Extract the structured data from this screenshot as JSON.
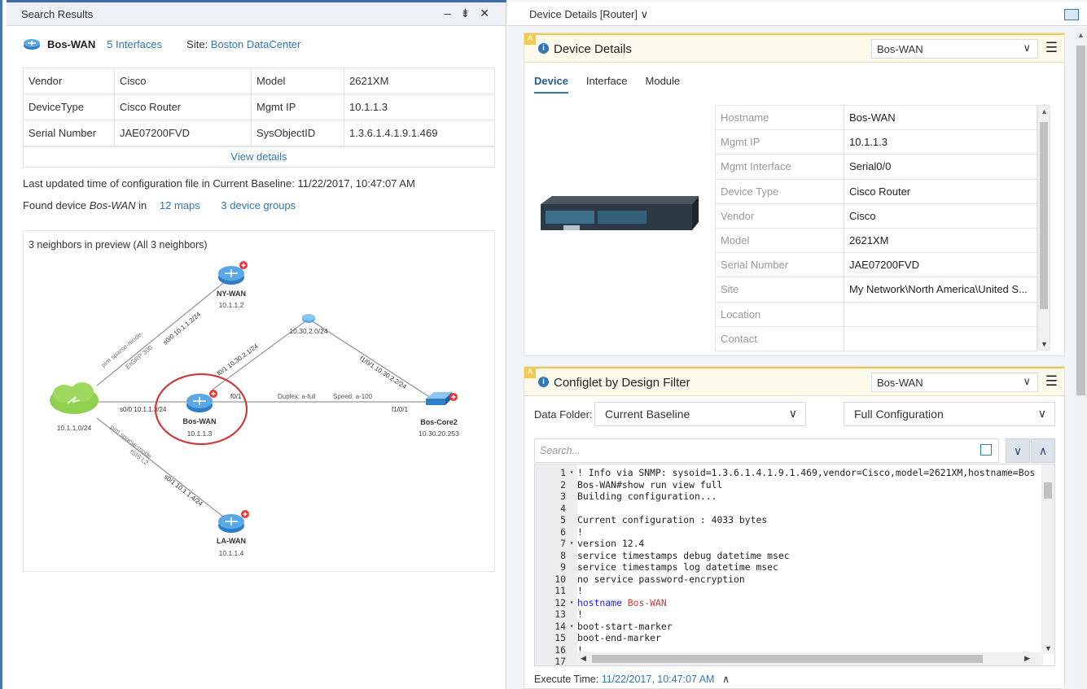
{
  "left": {
    "title": "Search Results",
    "window_buttons": [
      "–",
      "⇟",
      "✕"
    ],
    "device": {
      "name": "Bos-WAN",
      "interfaces": "5 Interfaces",
      "site_label": "Site:",
      "site": "Boston DataCenter"
    },
    "info_rows": [
      {
        "k1": "Vendor",
        "v1": "Cisco",
        "k2": "Model",
        "v2": "2621XM"
      },
      {
        "k1": "DeviceType",
        "v1": "Cisco Router",
        "k2": "Mgmt IP",
        "v2": "10.1.1.3"
      },
      {
        "k1": "Serial Number",
        "v1": "JAE07200FVD",
        "k2": "SysObjectID",
        "v2": "1.3.6.1.4.1.9.1.469"
      }
    ],
    "view_details": "View details",
    "updated_text": "Last updated time of configuration file in Current Baseline: 11/22/2017, 10:47:07 AM",
    "found_prefix": "Found device",
    "found_device": "Bos-WAN",
    "found_in": "in",
    "maps_link": "12 maps",
    "groups_link": "3 device groups",
    "map": {
      "caption": "3 neighbors in preview (All 3 neighbors)",
      "nodes": {
        "nywan": {
          "name": "NY-WAN",
          "ip": "10.1.1.2"
        },
        "boswan": {
          "name": "Bos-WAN",
          "ip": "10.1.1.3"
        },
        "boscore": {
          "name": "Bos-Core2",
          "ip": "10.30.20.253"
        },
        "lawan": {
          "name": "LA-WAN",
          "ip": "10.1.1.4"
        },
        "cloud": {
          "ip": "10.1.1.0/24"
        },
        "hub": {
          "ip": "10.30.2.0/24"
        }
      },
      "links": {
        "ny_if": "s0/0 10.1.1.2/24",
        "ny_proto1": "pim sparse-mode",
        "ny_proto2": "EIGRP 300",
        "bos_s0": "s0/0 10.1.1.3/24",
        "bos_f01": "f0/1 10.30.2.1/24",
        "bos_f0": "f0/1",
        "duplex": "Duplex: a-full",
        "speed": "Speed: a-100",
        "core_f1": "f1/0/1",
        "core_hub": "f1/0/1 10.30.2.2/24",
        "la_proto1": "pim sparse-mode",
        "la_proto2": "ISIS L2",
        "la_if": "s0/1 10.1.1.4/24"
      }
    }
  },
  "right": {
    "title": "Device Details [Router]",
    "title_chevron": "∨",
    "details_widget": {
      "badge": "A",
      "title": "Device Details",
      "selected": "Bos-WAN",
      "tabs": [
        "Device",
        "Interface",
        "Module"
      ],
      "rows": [
        {
          "k": "Hostname",
          "v": "Bos-WAN"
        },
        {
          "k": "Mgmt IP",
          "v": "10.1.1.3"
        },
        {
          "k": "Mgmt Interface",
          "v": "Serial0/0"
        },
        {
          "k": "Device Type",
          "v": "Cisco Router"
        },
        {
          "k": "Vendor",
          "v": "Cisco"
        },
        {
          "k": "Model",
          "v": "2621XM"
        },
        {
          "k": "Serial Number",
          "v": "JAE07200FVD"
        },
        {
          "k": "Site",
          "v": "My Network\\North America\\United S..."
        },
        {
          "k": "Location",
          "v": ""
        },
        {
          "k": "Contact",
          "v": ""
        }
      ]
    },
    "configlet_widget": {
      "badge": "A",
      "title": "Configlet by Design Filter",
      "selected": "Bos-WAN",
      "data_folder_label": "Data Folder:",
      "data_folder": "Current Baseline",
      "config_type": "Full Configuration",
      "search_placeholder": "Search...",
      "lines": [
        {
          "n": "1",
          "fold": "▾",
          "text": "! Info via SNMP: sysoid=1.3.6.1.4.1.9.1.469,vendor=Cisco,model=2621XM,hostname=Bos"
        },
        {
          "n": "2",
          "fold": "",
          "text": "Bos-WAN#show run view full"
        },
        {
          "n": "3",
          "fold": "",
          "text": "Building configuration..."
        },
        {
          "n": "4",
          "fold": "",
          "text": ""
        },
        {
          "n": "5",
          "fold": "",
          "text": "Current configuration : 4033 bytes"
        },
        {
          "n": "6",
          "fold": "",
          "text": "!"
        },
        {
          "n": "7",
          "fold": "▾",
          "text": "version 12.4"
        },
        {
          "n": "8",
          "fold": "",
          "text": "service timestamps debug datetime msec"
        },
        {
          "n": "9",
          "fold": "",
          "text": "service timestamps log datetime msec"
        },
        {
          "n": "10",
          "fold": "",
          "text": "no service password-encryption"
        },
        {
          "n": "11",
          "fold": "",
          "text": "!"
        },
        {
          "n": "12",
          "fold": "▾",
          "text": "",
          "kw": "hostname",
          "hn": "Bos-WAN"
        },
        {
          "n": "13",
          "fold": "",
          "text": "!"
        },
        {
          "n": "14",
          "fold": "▾",
          "text": "boot-start-marker"
        },
        {
          "n": "15",
          "fold": "",
          "text": "boot-end-marker"
        },
        {
          "n": "16",
          "fold": "",
          "text": "!"
        },
        {
          "n": "17",
          "fold": "",
          "text": ""
        }
      ],
      "exec_label": "Execute Time:",
      "exec_time": "11/22/2017, 10:47:07 AM",
      "exec_chevron": "∧"
    }
  },
  "colors": {
    "accent": "#2f78b8",
    "highlight_circle": "#d03a3a",
    "widget_header": "#fdfaeb",
    "badge": "#f4c84a"
  }
}
